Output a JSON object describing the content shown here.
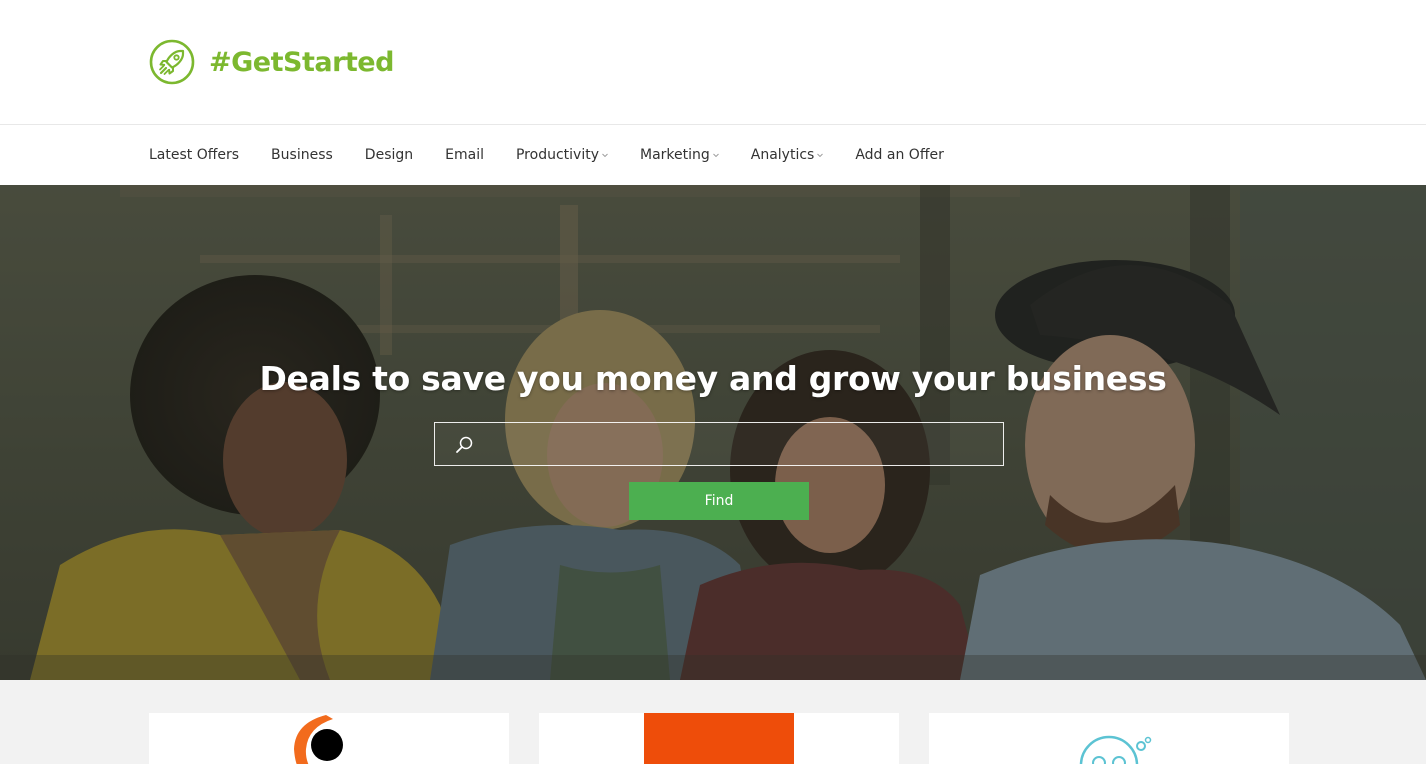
{
  "header": {
    "logo_text": "#GetStarted",
    "logo_icon": "rocket-icon",
    "brand_color": "#7cb82f"
  },
  "nav": {
    "items": [
      {
        "label": "Latest Offers",
        "dropdown": false
      },
      {
        "label": "Business",
        "dropdown": false
      },
      {
        "label": "Design",
        "dropdown": false
      },
      {
        "label": "Email",
        "dropdown": false
      },
      {
        "label": "Productivity",
        "dropdown": true
      },
      {
        "label": "Marketing",
        "dropdown": true
      },
      {
        "label": "Analytics",
        "dropdown": true
      },
      {
        "label": "Add an Offer",
        "dropdown": false
      }
    ]
  },
  "hero": {
    "title": "Deals to save you money and grow your business",
    "search": {
      "value": "",
      "placeholder": "",
      "icon": "search-icon"
    },
    "find_label": "Find",
    "find_color": "#4caf50"
  },
  "cards": [
    {
      "logo": "orange-ring-logo"
    },
    {
      "logo": "orange-square-logo"
    },
    {
      "logo": "blue-face-logo"
    }
  ]
}
